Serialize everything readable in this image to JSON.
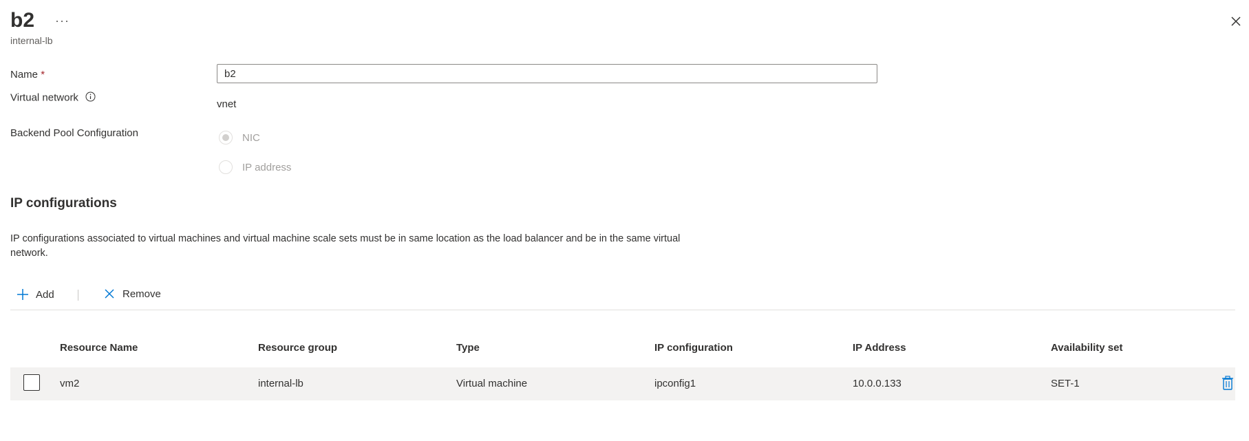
{
  "header": {
    "title": "b2",
    "more_label": "···",
    "subtitle": "internal-lb"
  },
  "form": {
    "name_label": "Name",
    "required_mark": "*",
    "name_value": "b2",
    "vnet_label": "Virtual network",
    "vnet_value": "vnet",
    "pool_config_label": "Backend Pool Configuration",
    "pool_options": [
      {
        "label": "NIC",
        "selected": true,
        "disabled": true
      },
      {
        "label": "IP address",
        "selected": false,
        "disabled": true
      }
    ]
  },
  "ip_section": {
    "title": "IP configurations",
    "description": "IP configurations associated to virtual machines and virtual machine scale sets must be in same location as the load balancer and be in the same virtual network."
  },
  "toolbar": {
    "add_label": "Add",
    "remove_label": "Remove"
  },
  "table": {
    "columns": [
      "Resource Name",
      "Resource group",
      "Type",
      "IP configuration",
      "IP Address",
      "Availability set"
    ],
    "rows": [
      [
        "vm2",
        "internal-lb",
        "Virtual machine",
        "ipconfig1",
        "10.0.0.133",
        "SET-1"
      ]
    ]
  },
  "colors": {
    "accent": "#0078d4",
    "row_background": "#f3f2f1",
    "required": "#a4262c"
  },
  "icons": {
    "close": "close-icon",
    "info": "info-icon",
    "add": "plus-icon",
    "remove": "x-icon",
    "delete": "trash-icon"
  }
}
